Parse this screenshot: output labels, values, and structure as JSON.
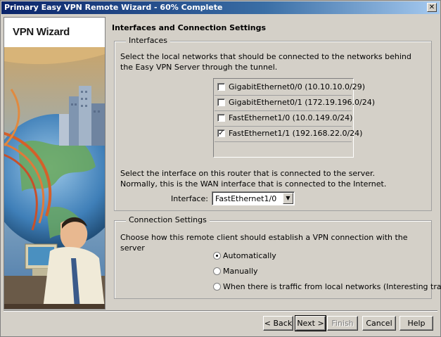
{
  "window": {
    "title": "Primary Easy VPN Remote Wizard - 60% Complete",
    "close_label": "✕"
  },
  "sidebar": {
    "title": "VPN Wizard"
  },
  "page": {
    "heading": "Interfaces and Connection Settings"
  },
  "interfaces": {
    "group_label": "Interfaces",
    "description": "Select the local networks that should be connected to the networks behind the Easy VPN Server through the tunnel.",
    "items": [
      {
        "label": "GigabitEthernet0/0 (10.10.10.0/29)",
        "checked": false
      },
      {
        "label": "GigabitEthernet0/1 (172.19.196.0/24)",
        "checked": false
      },
      {
        "label": "FastEthernet1/0 (10.0.149.0/24)",
        "checked": false
      },
      {
        "label": "FastEthernet1/1 (192.168.22.0/24)",
        "checked": true
      }
    ],
    "server_description": "Select the interface on this router that is connected to the server. Normally, this is the WAN interface that is connected to the Internet.",
    "interface_label": "Interface:",
    "interface_value": "FastEthernet1/0"
  },
  "connection": {
    "group_label": "Connection Settings",
    "description": "Choose how this remote client should establish a VPN connection with the server",
    "options": [
      {
        "label": "Automatically",
        "selected": true
      },
      {
        "label": "Manually",
        "selected": false
      },
      {
        "label": "When there is traffic from local networks (Interesting traffic)",
        "selected": false
      }
    ]
  },
  "buttons": {
    "back": "< Back",
    "next": "Next >",
    "finish": "Finish",
    "cancel": "Cancel",
    "help": "Help"
  }
}
